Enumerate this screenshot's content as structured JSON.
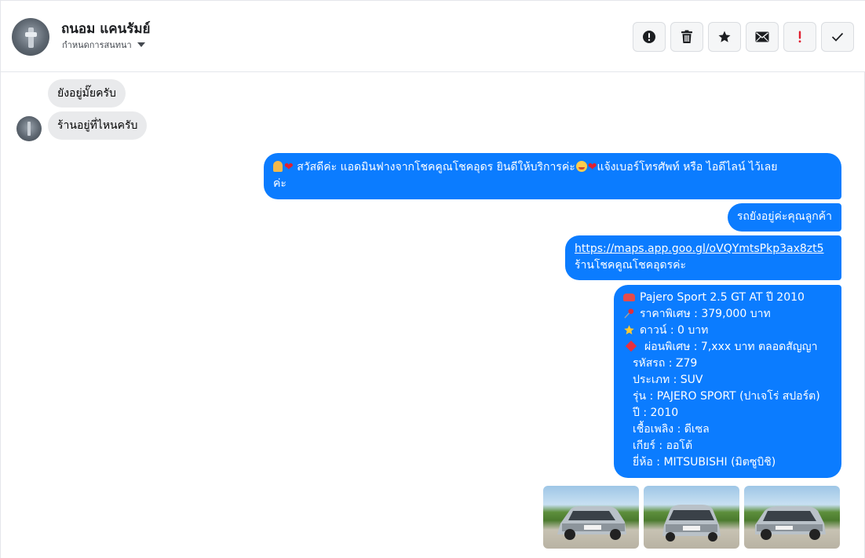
{
  "header": {
    "contact_name": "ถนอม แคนรัมย์",
    "assign_label": "กำหนดการสนทนา",
    "toolbar": [
      {
        "name": "report-button",
        "icon": "exclamation-circle-icon"
      },
      {
        "name": "delete-button",
        "icon": "trash-icon"
      },
      {
        "name": "star-button",
        "icon": "star-icon"
      },
      {
        "name": "mark-unread-button",
        "icon": "envelope-icon"
      },
      {
        "name": "important-button",
        "icon": "red-exclamation-icon"
      },
      {
        "name": "done-button",
        "icon": "check-icon"
      }
    ]
  },
  "messages": {
    "incoming": [
      "ยังอยู่มั๊ยครับ",
      "ร้านอยู่ที่ไหนครับ"
    ],
    "outgoing": {
      "greeting_part1": "สวัสดีค่ะ แอดมินฟางจากโชคคูณโชคอุดร ยินดีให้บริการค่ะ",
      "greeting_part2": "แจ้งเบอร์โทรศัพท์ หรือ ไอดีไลน์  ไว้เลย",
      "greeting_part3": "ค่ะ",
      "availability": "รถยังอยู่ค่ะคุณลูกค้า",
      "map_link": "https://maps.app.goo.gl/oVQYmtsPkp3ax8zt5",
      "shop_name": "ร้านโชคคูณโชคอุดรค่ะ",
      "listing": {
        "title": "Pajero Sport 2.5 GT AT ปี 2010",
        "price": "ราคาพิเศษ : 379,000 บาท",
        "down": "ดาวน์ : 0 บาท",
        "installment": "ผ่อนพิเศษ : 7,xxx บาท ตลอดสัญญา",
        "code": "รหัสรถ : Z79",
        "type": "ประเภท : SUV",
        "model": "รุ่น : PAJERO SPORT (ปาเจโร่ สปอร์ต)",
        "year": "ปี : 2010",
        "fuel": "เชื้อเพลิง : ดีเซล",
        "gear": "เกียร์ : ออโต้",
        "brand": "ยี่ห้อ : MITSUBISHI (มิตซูบิชิ)"
      }
    }
  },
  "colors": {
    "outgoing_bubble": "#0b7cff",
    "incoming_bubble": "#e9eaec",
    "important_red": "#e02030"
  }
}
